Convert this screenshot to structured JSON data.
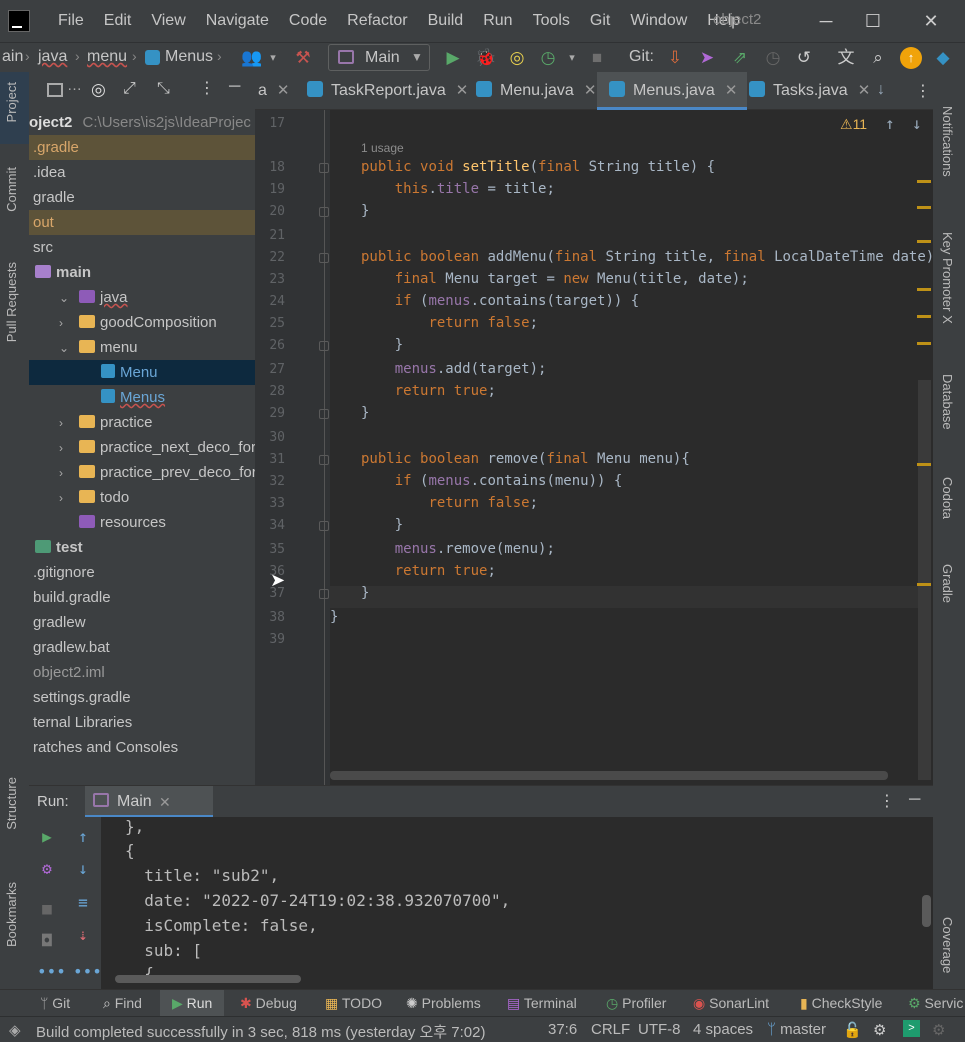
{
  "menu": {
    "items": [
      "File",
      "Edit",
      "View",
      "Navigate",
      "Code",
      "Refactor",
      "Build",
      "Run",
      "Tools",
      "Git",
      "Window",
      "Help"
    ],
    "title": "object2"
  },
  "toolbar": {
    "breadcrumbs": [
      "ain",
      "java",
      "menu",
      "Menus"
    ],
    "run_config": "Main",
    "git_label": "Git:"
  },
  "left_tabs": {
    "project": "Project",
    "commit": "Commit",
    "pull_requests": "Pull Requests",
    "structure": "Structure",
    "bookmarks": "Bookmarks"
  },
  "right_tabs": {
    "notifications": "Notifications",
    "key_promoter": "Key Promoter X",
    "database": "Database",
    "codota": "Codota",
    "gradle": "Gradle",
    "coverage": "Coverage"
  },
  "project": {
    "root_name": "oject2",
    "root_path": "C:\\Users\\is2js\\IdeaProjec",
    "items": [
      {
        "label": ".gradle",
        "depth": 0,
        "kind": "folder-excluded"
      },
      {
        "label": ".idea",
        "depth": 0,
        "kind": "folder"
      },
      {
        "label": "gradle",
        "depth": 0,
        "kind": "folder"
      },
      {
        "label": "out",
        "depth": 0,
        "kind": "folder-excluded"
      },
      {
        "label": "src",
        "depth": 0,
        "kind": "folder"
      },
      {
        "label": "main",
        "depth": 1,
        "kind": "folder-module"
      },
      {
        "label": "java",
        "depth": 2,
        "kind": "folder-src"
      },
      {
        "label": "goodComposition",
        "depth": 3,
        "kind": "package"
      },
      {
        "label": "menu",
        "depth": 3,
        "kind": "package-open"
      },
      {
        "label": "Menu",
        "depth": 4,
        "kind": "class"
      },
      {
        "label": "Menus",
        "depth": 4,
        "kind": "class"
      },
      {
        "label": "practice",
        "depth": 3,
        "kind": "package"
      },
      {
        "label": "practice_next_deco_for",
        "depth": 3,
        "kind": "package"
      },
      {
        "label": "practice_prev_deco_for",
        "depth": 3,
        "kind": "package"
      },
      {
        "label": "todo",
        "depth": 3,
        "kind": "package"
      },
      {
        "label": "resources",
        "depth": 2,
        "kind": "resources"
      },
      {
        "label": "test",
        "depth": 1,
        "kind": "folder-test"
      },
      {
        "label": ".gitignore",
        "depth": 0,
        "kind": "file"
      },
      {
        "label": "build.gradle",
        "depth": 0,
        "kind": "file"
      },
      {
        "label": "gradlew",
        "depth": 0,
        "kind": "file"
      },
      {
        "label": "gradlew.bat",
        "depth": 0,
        "kind": "file"
      },
      {
        "label": "object2.iml",
        "depth": 0,
        "kind": "file"
      },
      {
        "label": "settings.gradle",
        "depth": 0,
        "kind": "file"
      },
      {
        "label": "ternal Libraries",
        "depth": 0,
        "kind": "lib"
      },
      {
        "label": "ratches and Consoles",
        "depth": 0,
        "kind": "lib"
      }
    ]
  },
  "tabs": [
    {
      "label": "a"
    },
    {
      "label": "TaskReport.java"
    },
    {
      "label": "Menu.java"
    },
    {
      "label": "Menus.java"
    },
    {
      "label": "Tasks.java"
    }
  ],
  "editor": {
    "warnings": "11",
    "usages": "1 usage",
    "lines": [
      {
        "n": "17",
        "code": ""
      },
      {
        "n": "18",
        "code": "public void setTitle(final String title) {"
      },
      {
        "n": "19",
        "code": "    this.title = title;"
      },
      {
        "n": "20",
        "code": "}"
      },
      {
        "n": "21",
        "code": ""
      },
      {
        "n": "22",
        "code": "public boolean addMenu(final String title, final LocalDateTime date){"
      },
      {
        "n": "23",
        "code": "    final Menu target = new Menu(title, date);"
      },
      {
        "n": "24",
        "code": "    if (menus.contains(target)) {"
      },
      {
        "n": "25",
        "code": "        return false;"
      },
      {
        "n": "26",
        "code": "    }"
      },
      {
        "n": "27",
        "code": "    menus.add(target);"
      },
      {
        "n": "28",
        "code": "    return true;"
      },
      {
        "n": "29",
        "code": "}"
      },
      {
        "n": "30",
        "code": ""
      },
      {
        "n": "31",
        "code": "public boolean remove(final Menu menu){"
      },
      {
        "n": "32",
        "code": "    if (menus.contains(menu)) {"
      },
      {
        "n": "33",
        "code": "        return false;"
      },
      {
        "n": "34",
        "code": "    }"
      },
      {
        "n": "35",
        "code": "    menus.remove(menu);"
      },
      {
        "n": "36",
        "code": "    return true;"
      },
      {
        "n": "37",
        "code": "}"
      },
      {
        "n": "38",
        "code": "}"
      },
      {
        "n": "39",
        "code": ""
      }
    ]
  },
  "run": {
    "label": "Run:",
    "tab": "Main",
    "output": [
      "},",
      "{",
      "  title: \"sub2\",",
      "  date: \"2022-07-24T19:02:38.932070700\",",
      "  isComplete: false,",
      "  sub: [",
      "  {"
    ]
  },
  "bottom_tools": [
    "Git",
    "Find",
    "Run",
    "Debug",
    "TODO",
    "Problems",
    "Terminal",
    "Profiler",
    "SonarLint",
    "CheckStyle",
    "Servic"
  ],
  "status": {
    "message": "Build completed successfully in 3 sec, 818 ms (yesterday 오후 7:02)",
    "position": "37:6",
    "line_sep": "CRLF",
    "encoding": "UTF-8",
    "indent": "4 spaces",
    "branch": "master"
  },
  "colors": {
    "accent": "#4a88c7",
    "keyword": "#cc7832",
    "method": "#ffc66d",
    "field": "#9876aa",
    "selection": "#0d293e"
  }
}
